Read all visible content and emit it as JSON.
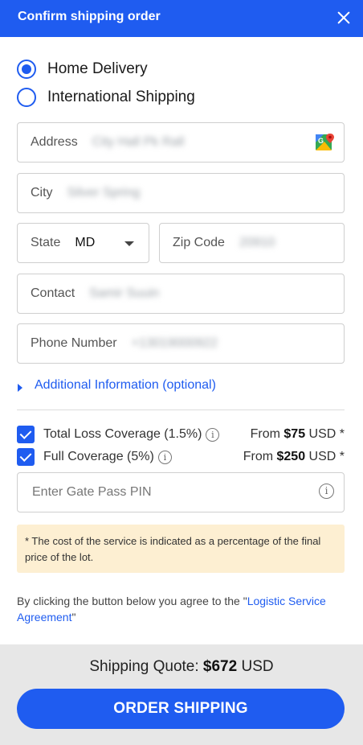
{
  "header": {
    "title": "Confirm shipping order",
    "close_icon": "close-icon"
  },
  "delivery_options": [
    {
      "label": "Home Delivery",
      "selected": true
    },
    {
      "label": "International Shipping",
      "selected": false
    }
  ],
  "form": {
    "address": {
      "label": "Address",
      "value": "City Hall Pk Rall",
      "icon": "google-maps-icon"
    },
    "city": {
      "label": "City",
      "value": "Silver Spring"
    },
    "state": {
      "label": "State",
      "value": "MD"
    },
    "zip": {
      "label": "Zip Code",
      "value": "20910"
    },
    "contact": {
      "label": "Contact",
      "value": "Samir Suuin"
    },
    "phone": {
      "label": "Phone Number",
      "value": "+13019000922"
    }
  },
  "additional_info": {
    "label": "Additional Information (optional)"
  },
  "coverage": [
    {
      "label": "Total Loss Coverage (1.5%)",
      "checked": true,
      "price_prefix": "From ",
      "price_amount": "$75",
      "price_suffix": " USD *"
    },
    {
      "label": "Full Coverage (5%)",
      "checked": true,
      "price_prefix": "From ",
      "price_amount": "$250",
      "price_suffix": " USD *"
    }
  ],
  "gate_pass": {
    "placeholder": "Enter Gate Pass PIN"
  },
  "notice": "* The cost of the service is indicated as a percentage of the final price of the lot.",
  "agreement": {
    "text_before": "By clicking the button below you agree to the \"",
    "link": "Logistic Service Agreement",
    "text_after": "\""
  },
  "footer": {
    "quote_label": "Shipping Quote: ",
    "quote_amount": "$672",
    "quote_currency": " USD",
    "button": "ORDER SHIPPING"
  },
  "colors": {
    "accent": "#1f5cf0",
    "notice_bg": "#fdefd2",
    "footer_bg": "#e7e7e7"
  }
}
